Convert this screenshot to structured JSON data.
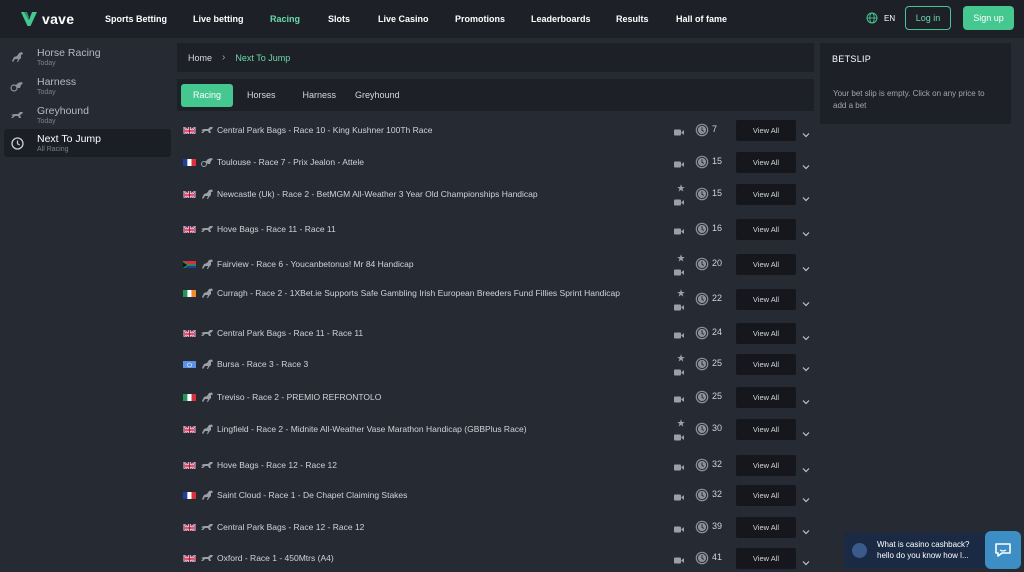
{
  "brand": {
    "name": "vave"
  },
  "nav": {
    "items": [
      {
        "label": "Sports Betting"
      },
      {
        "label": "Live betting"
      },
      {
        "label": "Racing",
        "active": true
      },
      {
        "label": "Slots"
      },
      {
        "label": "Live Casino"
      },
      {
        "label": "Promotions"
      },
      {
        "label": "Leaderboards"
      },
      {
        "label": "Results"
      },
      {
        "label": "Hall of fame"
      }
    ],
    "language": "EN",
    "login_label": "Log in",
    "signup_label": "Sign up"
  },
  "sidebar": {
    "items": [
      {
        "title": "Horse Racing",
        "sub": "Today",
        "icon": "horse-icon"
      },
      {
        "title": "Harness",
        "sub": "Today",
        "icon": "harness-icon"
      },
      {
        "title": "Greyhound",
        "sub": "Today",
        "icon": "greyhound-icon"
      },
      {
        "title": "Next To Jump",
        "sub": "All Racing",
        "icon": "clock-icon",
        "active": true
      }
    ]
  },
  "breadcrumb": {
    "home": "Home",
    "separator": "›",
    "current": "Next To Jump"
  },
  "tabs": [
    {
      "label": "Racing",
      "active": true
    },
    {
      "label": "Horses"
    },
    {
      "label": "Harness"
    },
    {
      "label": "Greyhound"
    }
  ],
  "races": [
    {
      "flag": "GB",
      "type": "greyhound",
      "name": "Central Park Bags - Race 10 - King Kushner 100Th Race",
      "mins": "7",
      "star": false,
      "view": "View All"
    },
    {
      "flag": "FR",
      "type": "harness",
      "name": "Toulouse - Race 7 - Prix Jealon - Attele",
      "mins": "15",
      "star": false,
      "view": "View All"
    },
    {
      "flag": "GB",
      "type": "horse",
      "name": "Newcastle (Uk) - Race 2 - BetMGM All-Weather 3 Year Old Championships Handicap",
      "mins": "15",
      "star": true,
      "view": "View All"
    },
    {
      "flag": "GB",
      "type": "greyhound",
      "name": "Hove Bags - Race 11 - Race 11",
      "mins": "16",
      "star": false,
      "view": "View All"
    },
    {
      "flag": "ZA",
      "type": "horse",
      "name": "Fairview - Race 6 - Youcanbetonus! Mr 84 Handicap",
      "mins": "20",
      "star": true,
      "view": "View All"
    },
    {
      "flag": "IE",
      "type": "horse",
      "name": "Curragh - Race 2 - 1XBet.ie Supports Safe Gambling Irish European Breeders Fund Fillies Sprint Handicap",
      "mins": "22",
      "star": true,
      "view": "View All"
    },
    {
      "flag": "GB",
      "type": "greyhound",
      "name": "Central Park Bags - Race 11 - Race 11",
      "mins": "24",
      "star": false,
      "view": "View All"
    },
    {
      "flag": "UN",
      "type": "horse",
      "name": "Bursa - Race 3 - Race 3",
      "mins": "25",
      "star": true,
      "view": "View All"
    },
    {
      "flag": "IT",
      "type": "horse",
      "name": "Treviso - Race 2 - PREMIO REFRONTOLO",
      "mins": "25",
      "star": false,
      "view": "View All"
    },
    {
      "flag": "GB",
      "type": "horse",
      "name": "Lingfield - Race 2 - Midnite All-Weather Vase Marathon Handicap (GBBPlus Race)",
      "mins": "30",
      "star": true,
      "view": "View All"
    },
    {
      "flag": "GB",
      "type": "greyhound",
      "name": "Hove Bags - Race 12 - Race 12",
      "mins": "32",
      "star": false,
      "view": "View All"
    },
    {
      "flag": "FR",
      "type": "horse",
      "name": "Saint Cloud - Race 1 - De Chapet Claiming Stakes",
      "mins": "32",
      "star": false,
      "view": "View All"
    },
    {
      "flag": "GB",
      "type": "greyhound",
      "name": "Central Park Bags - Race 12 - Race 12",
      "mins": "39",
      "star": false,
      "view": "View All"
    },
    {
      "flag": "GB",
      "type": "greyhound",
      "name": "Oxford - Race 1 - 450Mtrs (A4)",
      "mins": "41",
      "star": false,
      "view": "View All"
    }
  ],
  "betslip": {
    "title": "BETSLIP",
    "message": "Your bet slip is empty. Click on any price to add a bet"
  },
  "chat": {
    "line1": "What is casino cashback?",
    "line2": "hello do you know how l..."
  },
  "colors": {
    "accent": "#45c790",
    "accent_text": "#6ad9a9",
    "panel": "#1d2027",
    "background": "#262a33"
  }
}
